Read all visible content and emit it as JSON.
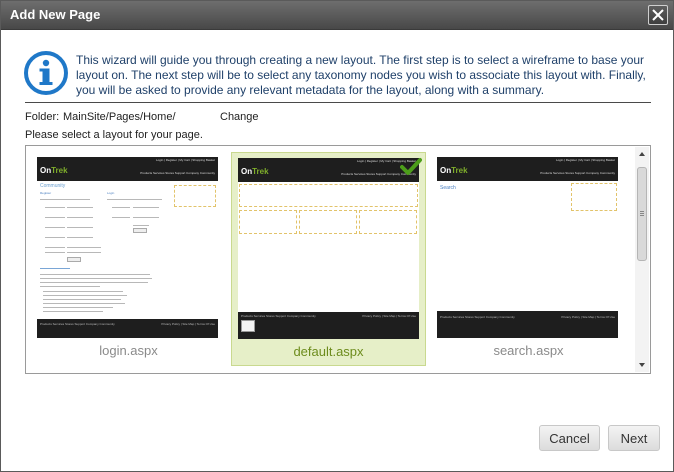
{
  "dialog": {
    "title": "Add New Page",
    "close_icon": "close-icon"
  },
  "intro": {
    "icon": "info-icon",
    "text": "This wizard will guide you through creating a new layout. The first step is to select a wireframe to base your layout on. The next step will be to select any taxonomy nodes you wish to associate this layout with. Finally, you will be asked to provide any relevant metadata for the layout, along with a summary."
  },
  "folder": {
    "label": "Folder:",
    "path": "MainSite/Pages/Home/",
    "change_label": "Change"
  },
  "prompt": "Please select a layout for your page.",
  "layouts": [
    {
      "name": "login.aspx",
      "selected": false
    },
    {
      "name": "default.aspx",
      "selected": true
    },
    {
      "name": "search.aspx",
      "selected": false
    }
  ],
  "thumbnail": {
    "brand_prefix": "On",
    "brand_suffix": "Trek",
    "top_links": "Login | Register | My Cart | Shopping Basket",
    "nav": "Products  Services  Stores  Support  Company  Community",
    "footer_text": "Privacy Policy | Site Map | Terms Of Use",
    "login_title": "Community",
    "login_sub": "Register",
    "login_col2": "Login",
    "search_title": "Search"
  },
  "buttons": {
    "cancel": "Cancel",
    "next": "Next"
  },
  "colors": {
    "accent_text": "#20416a",
    "selected_bg": "#e6efc8",
    "selected_label": "#6d8c1d",
    "check_green": "#4c9d1a"
  }
}
